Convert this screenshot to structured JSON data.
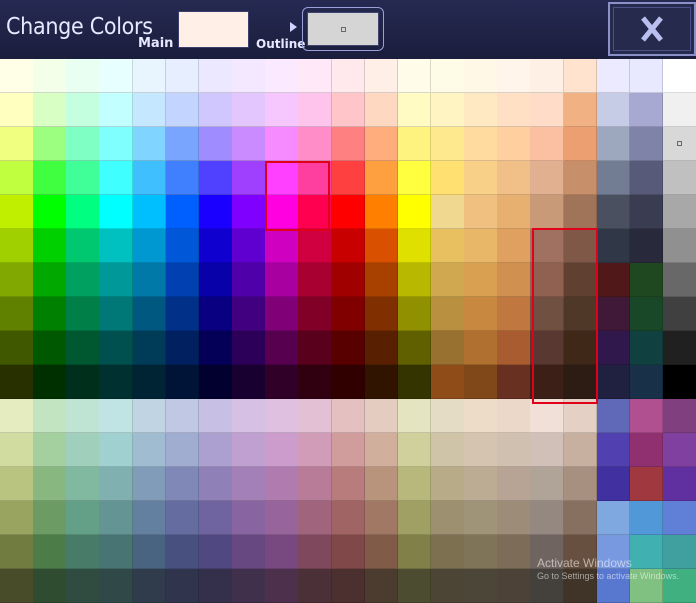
{
  "header": {
    "title": "Change Colors",
    "main_label": "Main",
    "outline_label": "Outline",
    "main_color": "#ffefe6",
    "outline_color": "#d5d5d5"
  },
  "close_button": {
    "icon": "close-x-icon",
    "color": "#b9c0f0"
  },
  "palette": {
    "rows": [
      [
        "#ffffe8",
        "#f4ffea",
        "#e8fff1",
        "#e7ffff",
        "#e8f5ff",
        "#e6eeff",
        "#ece8ff",
        "#f3e8ff",
        "#fbe9ff",
        "#ffe8f8",
        "#ffe9ec",
        "#ffefe6",
        "#fffde9",
        "#fefbe6",
        "#fff8e6",
        "#fff5ea",
        "#fff0e6",
        "#ffe3cf",
        "#eceaff",
        "#e8e8ff",
        "#ffffff"
      ],
      [
        "#ffffc0",
        "#d8ffc4",
        "#c4ffe0",
        "#c2ffff",
        "#c5e7ff",
        "#c3d5ff",
        "#d1c7ff",
        "#e4c6ff",
        "#f6c6ff",
        "#ffc4eb",
        "#ffc5c8",
        "#ffd8c2",
        "#fffbc2",
        "#fff4c2",
        "#ffe9c2",
        "#ffe0c4",
        "#ffdcc8",
        "#f2b182",
        "#c6cbe6",
        "#a8a9d2",
        "#f0f0f0"
      ],
      [
        "#f0ff80",
        "#9cff80",
        "#80ffc4",
        "#80ffff",
        "#7fd5ff",
        "#7aa5ff",
        "#9f8cff",
        "#c98bff",
        "#f58bff",
        "#ff8ec8",
        "#ff8080",
        "#ffad7d",
        "#fff380",
        "#ffe98e",
        "#ffdba0",
        "#ffcfa0",
        "#fac0a1",
        "#ec9f70",
        "#9da8bf",
        "#8083a8",
        "#d8d8d8"
      ],
      [
        "#c0ff40",
        "#40ff40",
        "#40ff98",
        "#40ffff",
        "#40bfff",
        "#4080ff",
        "#5040ff",
        "#a040ff",
        "#ff40ff",
        "#ff3f9f",
        "#ff4040",
        "#ffa040",
        "#ffff40",
        "#ffe070",
        "#f8d088",
        "#f0c088",
        "#e0b090",
        "#c8906a",
        "#727d94",
        "#585a7a",
        "#c0c0c0"
      ],
      [
        "#c0f000",
        "#00ff00",
        "#00ff80",
        "#00ffff",
        "#00bfff",
        "#0060ff",
        "#1a00ff",
        "#8000ff",
        "#ff00e0",
        "#ff0050",
        "#ff0000",
        "#ff8000",
        "#ffff00",
        "#f0d890",
        "#f0c080",
        "#e8b070",
        "#c89a78",
        "#a07458",
        "#4a5060",
        "#3a3c52",
        "#a8a8a8"
      ],
      [
        "#a0d000",
        "#00d000",
        "#00c870",
        "#00c0c0",
        "#0098d0",
        "#0058d8",
        "#1000d0",
        "#6000d0",
        "#d000c0",
        "#d00040",
        "#c80000",
        "#d85000",
        "#e0e000",
        "#e8c060",
        "#e8b868",
        "#e0a060",
        "#a07060",
        "#805848",
        "#303848",
        "#282a3c",
        "#909090"
      ],
      [
        "#80a800",
        "#00a800",
        "#00a060",
        "#009898",
        "#0078a8",
        "#0040b0",
        "#0800a8",
        "#5000a8",
        "#a800a0",
        "#a80030",
        "#a00000",
        "#a84000",
        "#b8b800",
        "#d0a850",
        "#d8a050",
        "#d09050",
        "#906050",
        "#604030",
        "#501818",
        "#204820",
        "#686868"
      ],
      [
        "#608000",
        "#008000",
        "#008048",
        "#007878",
        "#005880",
        "#003088",
        "#080080",
        "#400080",
        "#800078",
        "#800028",
        "#800000",
        "#803000",
        "#909000",
        "#b89040",
        "#c88840",
        "#c07840",
        "#705040",
        "#503828",
        "#401838",
        "#184828",
        "#404040"
      ],
      [
        "#405800",
        "#005800",
        "#005830",
        "#005050",
        "#003c58",
        "#002060",
        "#040058",
        "#2c0058",
        "#580050",
        "#58001c",
        "#580000",
        "#582000",
        "#606000",
        "#987030",
        "#b07030",
        "#a85c30",
        "#583830",
        "#402818",
        "#30184c",
        "#104040",
        "#202020"
      ],
      [
        "#283000",
        "#003000",
        "#00301c",
        "#003030",
        "#002434",
        "#001438",
        "#02002e",
        "#180030",
        "#300028",
        "#300010",
        "#300000",
        "#301400",
        "#343400",
        "#904c18",
        "#804818",
        "#683020",
        "#3c2018",
        "#2c1c14",
        "#202040",
        "#183048",
        "#000000"
      ],
      [
        "#e4ecc0",
        "#c2e4c0",
        "#c0e4d4",
        "#c0e4e4",
        "#c0d4e4",
        "#c0c8e4",
        "#c8c0e4",
        "#d6c0e4",
        "#e0c0e0",
        "#e4c0d4",
        "#e4c0c0",
        "#e4ccc0",
        "#e4e4c0",
        "#e4dcc4",
        "#ecdcc8",
        "#ecd8c8",
        "#f0e0d8",
        "#e4d0c4",
        "#6068b8",
        "#b05090",
        "#804080"
      ],
      [
        "#d0dca0",
        "#a4d0a0",
        "#a0d0bc",
        "#a0d0d0",
        "#a0bcd0",
        "#a0acd0",
        "#aca0d0",
        "#c0a0d0",
        "#cc9ccc",
        "#d09cb8",
        "#d09c9c",
        "#d0b09c",
        "#d0d09c",
        "#d0c4a8",
        "#d4c4b0",
        "#d0c0b0",
        "#d0c0b8",
        "#c8b0a0",
        "#5040b0",
        "#903070",
        "#8040a0"
      ],
      [
        "#b8c480",
        "#88b880",
        "#80b8a0",
        "#80b0b0",
        "#809cb8",
        "#8088b8",
        "#9080b8",
        "#a480b8",
        "#b07cb0",
        "#b87c98",
        "#b87c7c",
        "#b8947c",
        "#b8b87c",
        "#b8ac88",
        "#bcac94",
        "#b8a494",
        "#b0a498",
        "#a89080",
        "#4030a0",
        "#a03840",
        "#6030a0"
      ],
      [
        "#98a460",
        "#6c9c64",
        "#64a088",
        "#649494",
        "#6480a0",
        "#646ca0",
        "#7064a0",
        "#8864a0",
        "#98649c",
        "#a0647c",
        "#a06464",
        "#a07864",
        "#a0a064",
        "#9c9070",
        "#a09478",
        "#9c8c78",
        "#948880",
        "#887060",
        "#80a8e0",
        "#5098d8",
        "#6080d8"
      ],
      [
        "#707c40",
        "#4c7c48",
        "#487c68",
        "#487474",
        "#486480",
        "#485080",
        "#504880",
        "#684880",
        "#784880",
        "#80485c",
        "#804848",
        "#805c48",
        "#808048",
        "#7c7050",
        "#807458",
        "#7c6c58",
        "#706460",
        "#685040",
        "#7898e0",
        "#40b0b0",
        "#40a0a0"
      ],
      [
        "#484c28",
        "#304c30",
        "#304c40",
        "#304848",
        "#303c4c",
        "#30344c",
        "#34304c",
        "#40304c",
        "#4c304c",
        "#4c3038",
        "#4c3030",
        "#4c3c30",
        "#4c4c30",
        "#4c4434",
        "#4c4638",
        "#4c4238",
        "#44403c",
        "#403428",
        "#5878d0",
        "#80c080",
        "#40b080"
      ]
    ]
  }
}
